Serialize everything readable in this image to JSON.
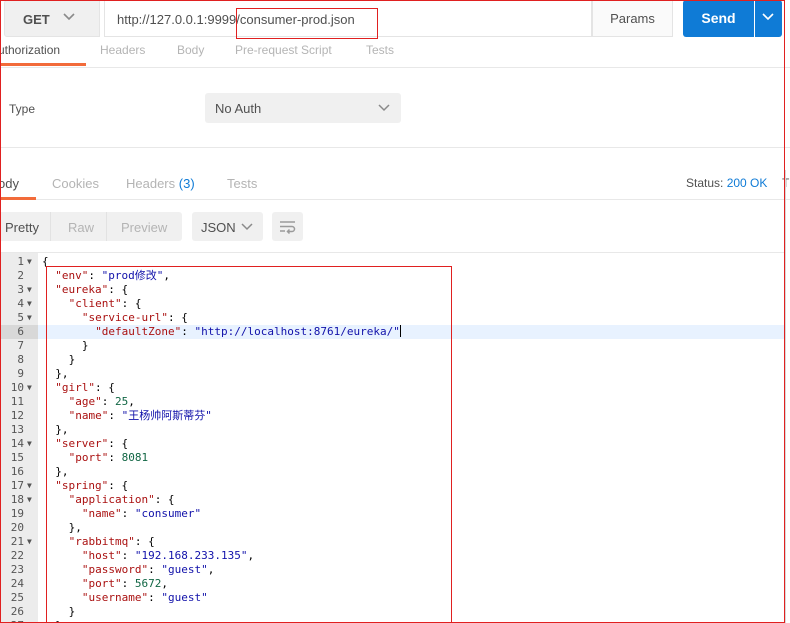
{
  "request": {
    "method": "GET",
    "url": "http://127.0.0.1:9999/consumer-prod.json",
    "params_label": "Params",
    "send_label": "Send"
  },
  "request_tabs": [
    "uthorization",
    "Headers",
    "Body",
    "Pre-request Script",
    "Tests"
  ],
  "auth": {
    "type_label": "Type",
    "type_value": "No Auth"
  },
  "response_tabs": {
    "body": "ody",
    "cookies": "Cookies",
    "headers": "Headers",
    "headers_count": "(3)",
    "tests": "Tests"
  },
  "status": {
    "label": "Status:",
    "value": "200 OK",
    "extra": "T"
  },
  "format": {
    "pretty": "Pretty",
    "raw": "Raw",
    "preview": "Preview",
    "language": "JSON"
  },
  "colors": {
    "accent": "#0f7bd6",
    "tab_active": "#f26b3a",
    "annotation": "#e02020"
  },
  "code_lines": [
    {
      "n": "1",
      "fold": true,
      "indent": 0,
      "parts": [
        [
          "p",
          "{"
        ]
      ]
    },
    {
      "n": "2",
      "fold": false,
      "indent": 1,
      "parts": [
        [
          "k",
          "\"env\""
        ],
        [
          "p",
          ": "
        ],
        [
          "s",
          "\"prod修改\""
        ],
        [
          "p",
          ","
        ]
      ]
    },
    {
      "n": "3",
      "fold": true,
      "indent": 1,
      "parts": [
        [
          "k",
          "\"eureka\""
        ],
        [
          "p",
          ": {"
        ]
      ]
    },
    {
      "n": "4",
      "fold": true,
      "indent": 2,
      "parts": [
        [
          "k",
          "\"client\""
        ],
        [
          "p",
          ": {"
        ]
      ]
    },
    {
      "n": "5",
      "fold": true,
      "indent": 3,
      "parts": [
        [
          "k",
          "\"service-url\""
        ],
        [
          "p",
          ": {"
        ]
      ]
    },
    {
      "n": "6",
      "fold": false,
      "indent": 4,
      "highlight": true,
      "parts": [
        [
          "k",
          "\"defaultZone\""
        ],
        [
          "p",
          ": "
        ],
        [
          "s",
          "\"http://localhost:8761/eureka/\""
        ]
      ]
    },
    {
      "n": "7",
      "fold": false,
      "indent": 3,
      "parts": [
        [
          "p",
          "}"
        ]
      ]
    },
    {
      "n": "8",
      "fold": false,
      "indent": 2,
      "parts": [
        [
          "p",
          "}"
        ]
      ]
    },
    {
      "n": "9",
      "fold": false,
      "indent": 1,
      "parts": [
        [
          "p",
          "},"
        ]
      ]
    },
    {
      "n": "10",
      "fold": true,
      "indent": 1,
      "parts": [
        [
          "k",
          "\"girl\""
        ],
        [
          "p",
          ": {"
        ]
      ]
    },
    {
      "n": "11",
      "fold": false,
      "indent": 2,
      "parts": [
        [
          "k",
          "\"age\""
        ],
        [
          "p",
          ": "
        ],
        [
          "n",
          "25"
        ],
        [
          "p",
          ","
        ]
      ]
    },
    {
      "n": "12",
      "fold": false,
      "indent": 2,
      "parts": [
        [
          "k",
          "\"name\""
        ],
        [
          "p",
          ": "
        ],
        [
          "s",
          "\"王杨帅阿斯蒂芬\""
        ]
      ]
    },
    {
      "n": "13",
      "fold": false,
      "indent": 1,
      "parts": [
        [
          "p",
          "},"
        ]
      ]
    },
    {
      "n": "14",
      "fold": true,
      "indent": 1,
      "parts": [
        [
          "k",
          "\"server\""
        ],
        [
          "p",
          ": {"
        ]
      ]
    },
    {
      "n": "15",
      "fold": false,
      "indent": 2,
      "parts": [
        [
          "k",
          "\"port\""
        ],
        [
          "p",
          ": "
        ],
        [
          "n",
          "8081"
        ]
      ]
    },
    {
      "n": "16",
      "fold": false,
      "indent": 1,
      "parts": [
        [
          "p",
          "},"
        ]
      ]
    },
    {
      "n": "17",
      "fold": true,
      "indent": 1,
      "parts": [
        [
          "k",
          "\"spring\""
        ],
        [
          "p",
          ": {"
        ]
      ]
    },
    {
      "n": "18",
      "fold": true,
      "indent": 2,
      "parts": [
        [
          "k",
          "\"application\""
        ],
        [
          "p",
          ": {"
        ]
      ]
    },
    {
      "n": "19",
      "fold": false,
      "indent": 3,
      "parts": [
        [
          "k",
          "\"name\""
        ],
        [
          "p",
          ": "
        ],
        [
          "s",
          "\"consumer\""
        ]
      ]
    },
    {
      "n": "20",
      "fold": false,
      "indent": 2,
      "parts": [
        [
          "p",
          "},"
        ]
      ]
    },
    {
      "n": "21",
      "fold": true,
      "indent": 2,
      "parts": [
        [
          "k",
          "\"rabbitmq\""
        ],
        [
          "p",
          ": {"
        ]
      ]
    },
    {
      "n": "22",
      "fold": false,
      "indent": 3,
      "parts": [
        [
          "k",
          "\"host\""
        ],
        [
          "p",
          ": "
        ],
        [
          "s",
          "\"192.168.233.135\""
        ],
        [
          "p",
          ","
        ]
      ]
    },
    {
      "n": "23",
      "fold": false,
      "indent": 3,
      "parts": [
        [
          "k",
          "\"password\""
        ],
        [
          "p",
          ": "
        ],
        [
          "s",
          "\"guest\""
        ],
        [
          "p",
          ","
        ]
      ]
    },
    {
      "n": "24",
      "fold": false,
      "indent": 3,
      "parts": [
        [
          "k",
          "\"port\""
        ],
        [
          "p",
          ": "
        ],
        [
          "n",
          "5672"
        ],
        [
          "p",
          ","
        ]
      ]
    },
    {
      "n": "25",
      "fold": false,
      "indent": 3,
      "parts": [
        [
          "k",
          "\"username\""
        ],
        [
          "p",
          ": "
        ],
        [
          "s",
          "\"guest\""
        ]
      ]
    },
    {
      "n": "26",
      "fold": false,
      "indent": 2,
      "parts": [
        [
          "p",
          "}"
        ]
      ]
    },
    {
      "n": "27",
      "fold": false,
      "indent": 1,
      "parts": [
        [
          "p",
          "}"
        ]
      ]
    }
  ]
}
